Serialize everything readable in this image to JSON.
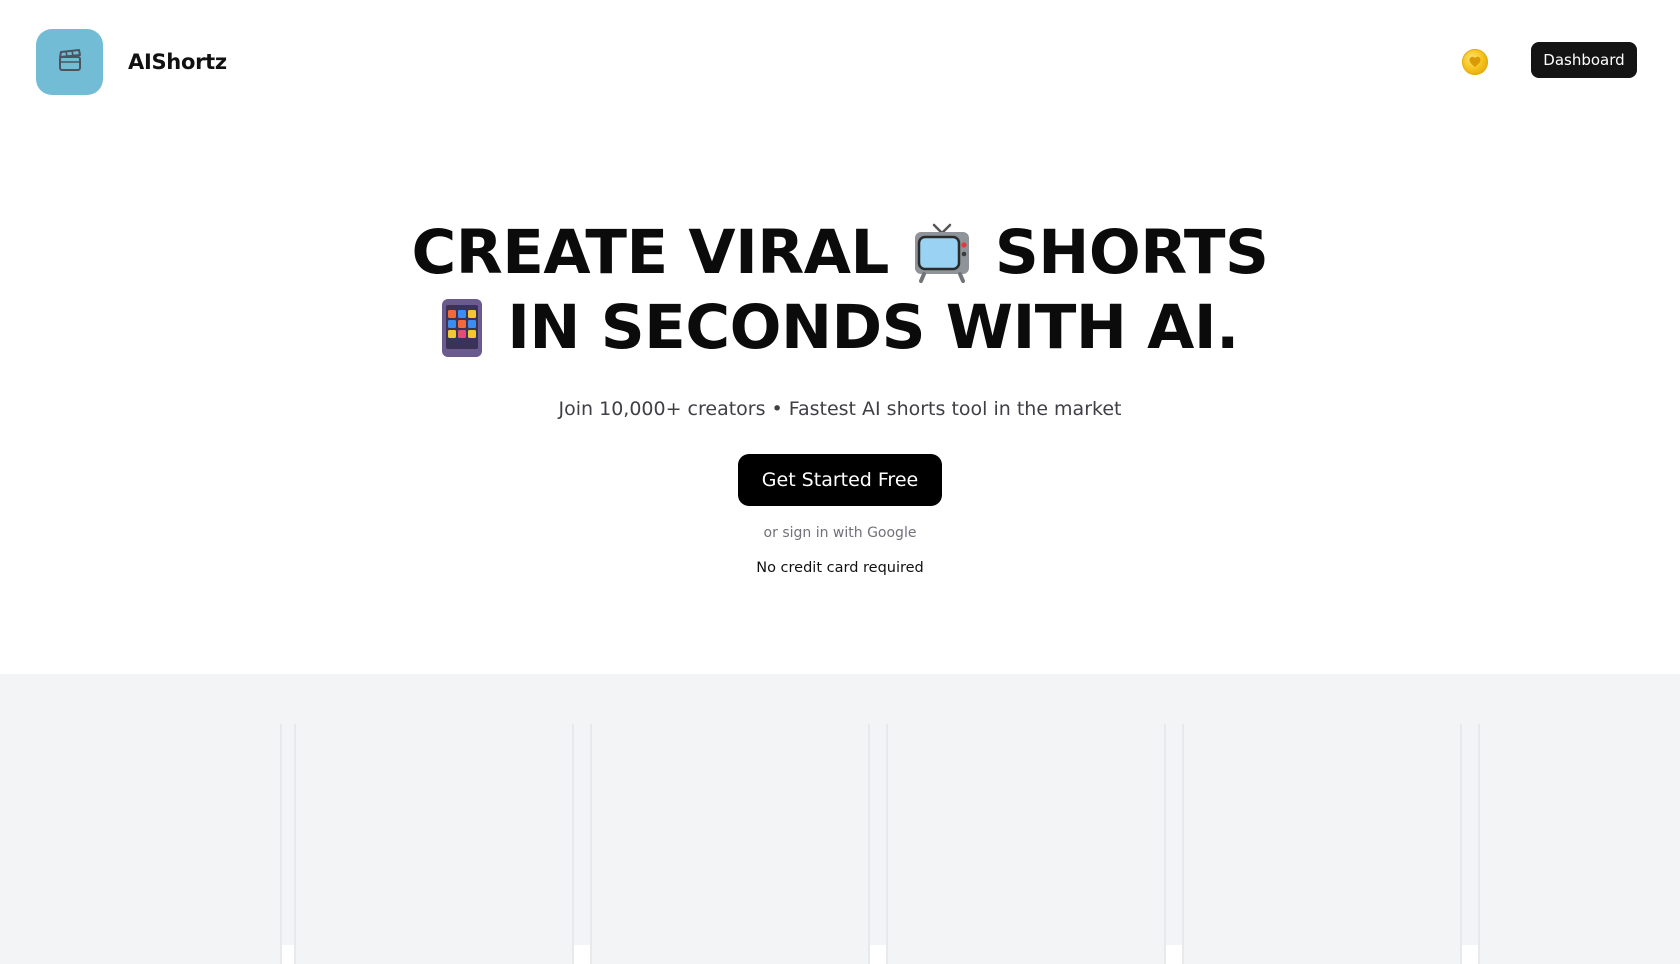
{
  "header": {
    "brand_name": "AIShortz",
    "logo_icon": "clapperboard-icon",
    "coin_icon": "coin-icon",
    "dashboard_label": "Dashboard"
  },
  "hero": {
    "headline_line1_part1": "CREATE VIRAL",
    "headline_line1_icon": "tv-emoji",
    "headline_line1_part2": "SHORTS",
    "headline_line2_icon": "phone-apps-emoji",
    "headline_line2_text": "IN SECONDS WITH AI.",
    "subtitle": "Join 10,000+ creators • Fastest AI shorts tool in the market",
    "cta_label": "Get Started Free",
    "signin_text": "or sign in with Google",
    "no_card_text": "No credit card required"
  },
  "colors": {
    "logo_tile": "#72bdd5",
    "dashboard_button": "#141414",
    "cta_button": "#000000",
    "gallery_background": "#f3f4f6",
    "coin": "#f6c31c"
  }
}
